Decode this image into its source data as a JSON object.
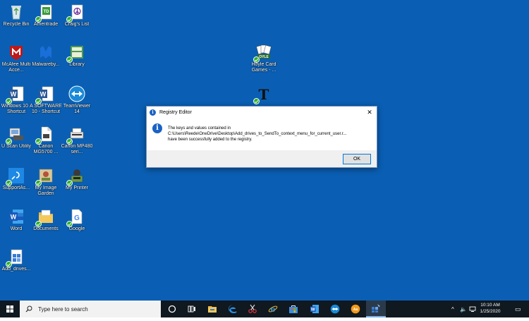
{
  "desktop": {
    "background": "#0a5fb4",
    "icons": [
      {
        "label": "Recycle Bin"
      },
      {
        "label": "Ameritrade"
      },
      {
        "label": "Craig's List"
      },
      {
        "label": "McAfee Multi Acce..."
      },
      {
        "label": "Malwareby..."
      },
      {
        "label": "Library"
      },
      {
        "label": "Hoyle Card Games - ..."
      },
      {
        "label": "Windows 10 - Shortcut"
      },
      {
        "label": "A SOFTWARE 10 - Shortcut"
      },
      {
        "label": "TeamViewer 14"
      },
      {
        "label": "U Scan Utility"
      },
      {
        "label": "Canon MG5700 ..."
      },
      {
        "label": "Canon MP480 seri..."
      },
      {
        "label": "SupportAs..."
      },
      {
        "label": "My Image Garden"
      },
      {
        "label": "My Printer"
      },
      {
        "label": "Word"
      },
      {
        "label": "Documents"
      },
      {
        "label": "Google"
      },
      {
        "label": "Add_drives..."
      }
    ]
  },
  "dialog": {
    "title": "Registry Editor",
    "close_glyph": "✕",
    "message_line1": "The keys and values contained in",
    "message_line2": "C:\\Users\\Reede\\OneDrive\\Desktop\\Add_drives_to_SendTo_context_menu_for_current_user.r...",
    "message_line3": "have been successfully added to the registry.",
    "ok_label": "OK"
  },
  "taskbar": {
    "search_placeholder": "Type here to search",
    "clock_time": "10:10 AM",
    "clock_date": "1/25/2020",
    "tray_chevron": "^",
    "volume_glyph": "🔈",
    "notification_glyph": "▭"
  }
}
